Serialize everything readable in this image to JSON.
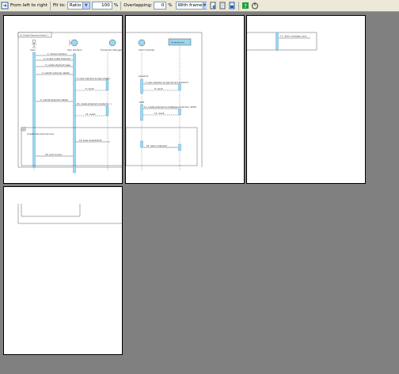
{
  "toolbar": {
    "order_label": "From left to right",
    "fit_label": "Fit to:",
    "fit_value": "Ratio",
    "ratio_value": "100",
    "percent_symbol": "%",
    "overlap_label": "Overlapping:",
    "overlap_value": "0",
    "frame_value": "With frame"
  },
  "diagram": {
    "frame_title": "sd Create Shipment (test) 1",
    "lifelines": [
      "Clerk",
      "User Interface",
      "Transaction Manager",
      "Clerk Controller",
      "OrderService"
    ],
    "messages": [
      "1: Shows Interface",
      "2: accept create shipment",
      "3: create shipment page",
      "4: submit customer details",
      "5: load customer to login (Clerk)",
      "6: result",
      "7: load customer to login ID and password",
      "8: result",
      "9: submit shipment details",
      "10: create shipment (Customer...)",
      "11: create shipment to database (Customer, Staff)",
      "12: result",
      "13: result",
      "14: save receipt/ment",
      "15: return shipment",
      "16: print invoice",
      "17: return message: save"
    ],
    "fragment_label": "[Create shipment service]",
    "fragment_op": "alt",
    "clipped_labels": [
      "password",
      "Staff"
    ]
  }
}
